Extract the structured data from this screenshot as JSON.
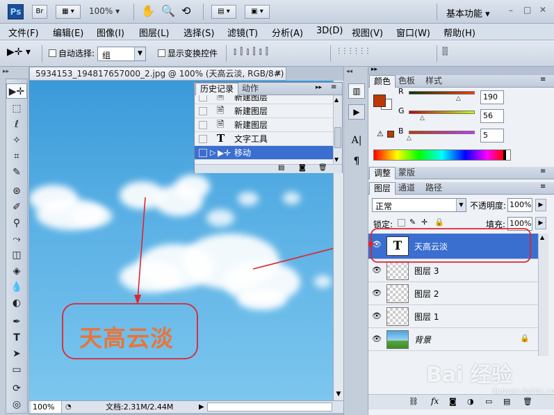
{
  "app": {
    "logo": "Ps",
    "bridge": "Br",
    "zoom_dropdown": "100%",
    "workspace": "基本功能",
    "window_controls": [
      "–",
      "□",
      "✕"
    ]
  },
  "menu": [
    "文件(F)",
    "编辑(E)",
    "图像(I)",
    "图层(L)",
    "选择(S)",
    "滤镜(T)",
    "分析(A)",
    "3D(D)",
    "视图(V)",
    "窗口(W)",
    "帮助(H)"
  ],
  "options": {
    "auto_select_label": "自动选择:",
    "auto_select_value": "组",
    "show_transform_label": "显示变换控件"
  },
  "document": {
    "tab_title": "5934153_194817657000_2.jpg @ 100% (天高云淡, RGB/8#) *",
    "canvas_text": "天高云淡",
    "zoom": "100%",
    "doc_size": "文档:2.31M/2.44M"
  },
  "history": {
    "tabs": [
      "历史记录",
      "动作"
    ],
    "items": [
      {
        "icon": "document-icon",
        "label": "新建图层",
        "selected": false
      },
      {
        "icon": "document-icon",
        "label": "新建图层",
        "selected": false
      },
      {
        "icon": "document-icon",
        "label": "新建图层",
        "selected": false
      },
      {
        "icon": "type-icon",
        "label": "文字工具",
        "selected": false
      },
      {
        "icon": "move-icon",
        "label": "移动",
        "selected": true
      }
    ]
  },
  "color": {
    "tabs": [
      "颜色",
      "色板",
      "样式"
    ],
    "r_label": "R",
    "r_value": "190",
    "g_label": "G",
    "g_value": "56",
    "b_label": "B",
    "b_value": "5",
    "r": 190,
    "g": 56,
    "b": 5,
    "foreground": "#be3805"
  },
  "adjust": {
    "tabs": [
      "调整",
      "蒙版"
    ]
  },
  "layers": {
    "tabs": [
      "图层",
      "通道",
      "路径"
    ],
    "blend_mode": "正常",
    "opacity_label": "不透明度:",
    "opacity_value": "100%",
    "lock_label": "锁定:",
    "fill_label": "填充:",
    "fill_value": "100%",
    "items": [
      {
        "name": "天高云淡",
        "type": "text",
        "selected": true,
        "thumb": "T"
      },
      {
        "name": "图层 3",
        "type": "pixel",
        "selected": false
      },
      {
        "name": "图层 2",
        "type": "pixel",
        "selected": false
      },
      {
        "name": "图层 1",
        "type": "pixel",
        "selected": false
      },
      {
        "name": "背景",
        "type": "background",
        "selected": false
      }
    ]
  },
  "watermark": {
    "text": "Bai 经验",
    "url": "jingyan.baidu.com"
  },
  "annotation_color": "#e0242f",
  "text_color": "#e8753a"
}
